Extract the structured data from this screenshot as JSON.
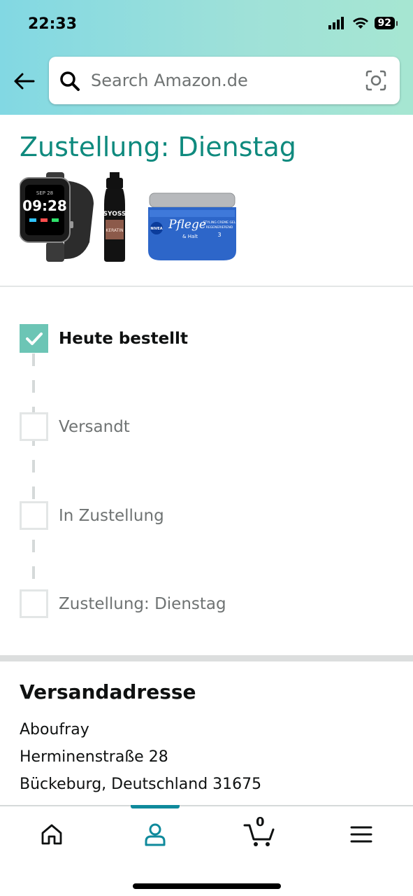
{
  "status_bar": {
    "time": "22:33",
    "battery": "92"
  },
  "search": {
    "placeholder": "Search Amazon.de"
  },
  "delivery": {
    "title": "Zustellung: Dienstag"
  },
  "products": [
    {
      "name": "smartwatch",
      "watch_time": "09:28",
      "watch_date": "SEP 28"
    },
    {
      "name": "shampoo",
      "brand": "SYOSS",
      "variant": "KERATIN"
    },
    {
      "name": "styling-gel",
      "brand": "NIVEA",
      "script": "Pflege",
      "sub": "& Halt",
      "desc1": "STYLING CREME GEL",
      "desc2": "REGENERIEREND"
    }
  ],
  "tracking": {
    "steps": [
      {
        "label": "Heute bestellt",
        "done": true
      },
      {
        "label": "Versandt",
        "done": false
      },
      {
        "label": "In Zustellung",
        "done": false
      },
      {
        "label": "Zustellung: Dienstag",
        "done": false
      }
    ]
  },
  "address": {
    "heading": "Versandadresse",
    "lines": [
      "Aboufray",
      "Herminenstraße 28",
      "Bückeburg, Deutschland 31675"
    ]
  },
  "tabbar": {
    "tabs": [
      "home",
      "account",
      "cart",
      "menu"
    ],
    "active": "account",
    "cart_count": "0",
    "accent_color": "#0f8a9c"
  },
  "colors": {
    "title": "#0f8a7e",
    "check": "#6cc5b5"
  }
}
